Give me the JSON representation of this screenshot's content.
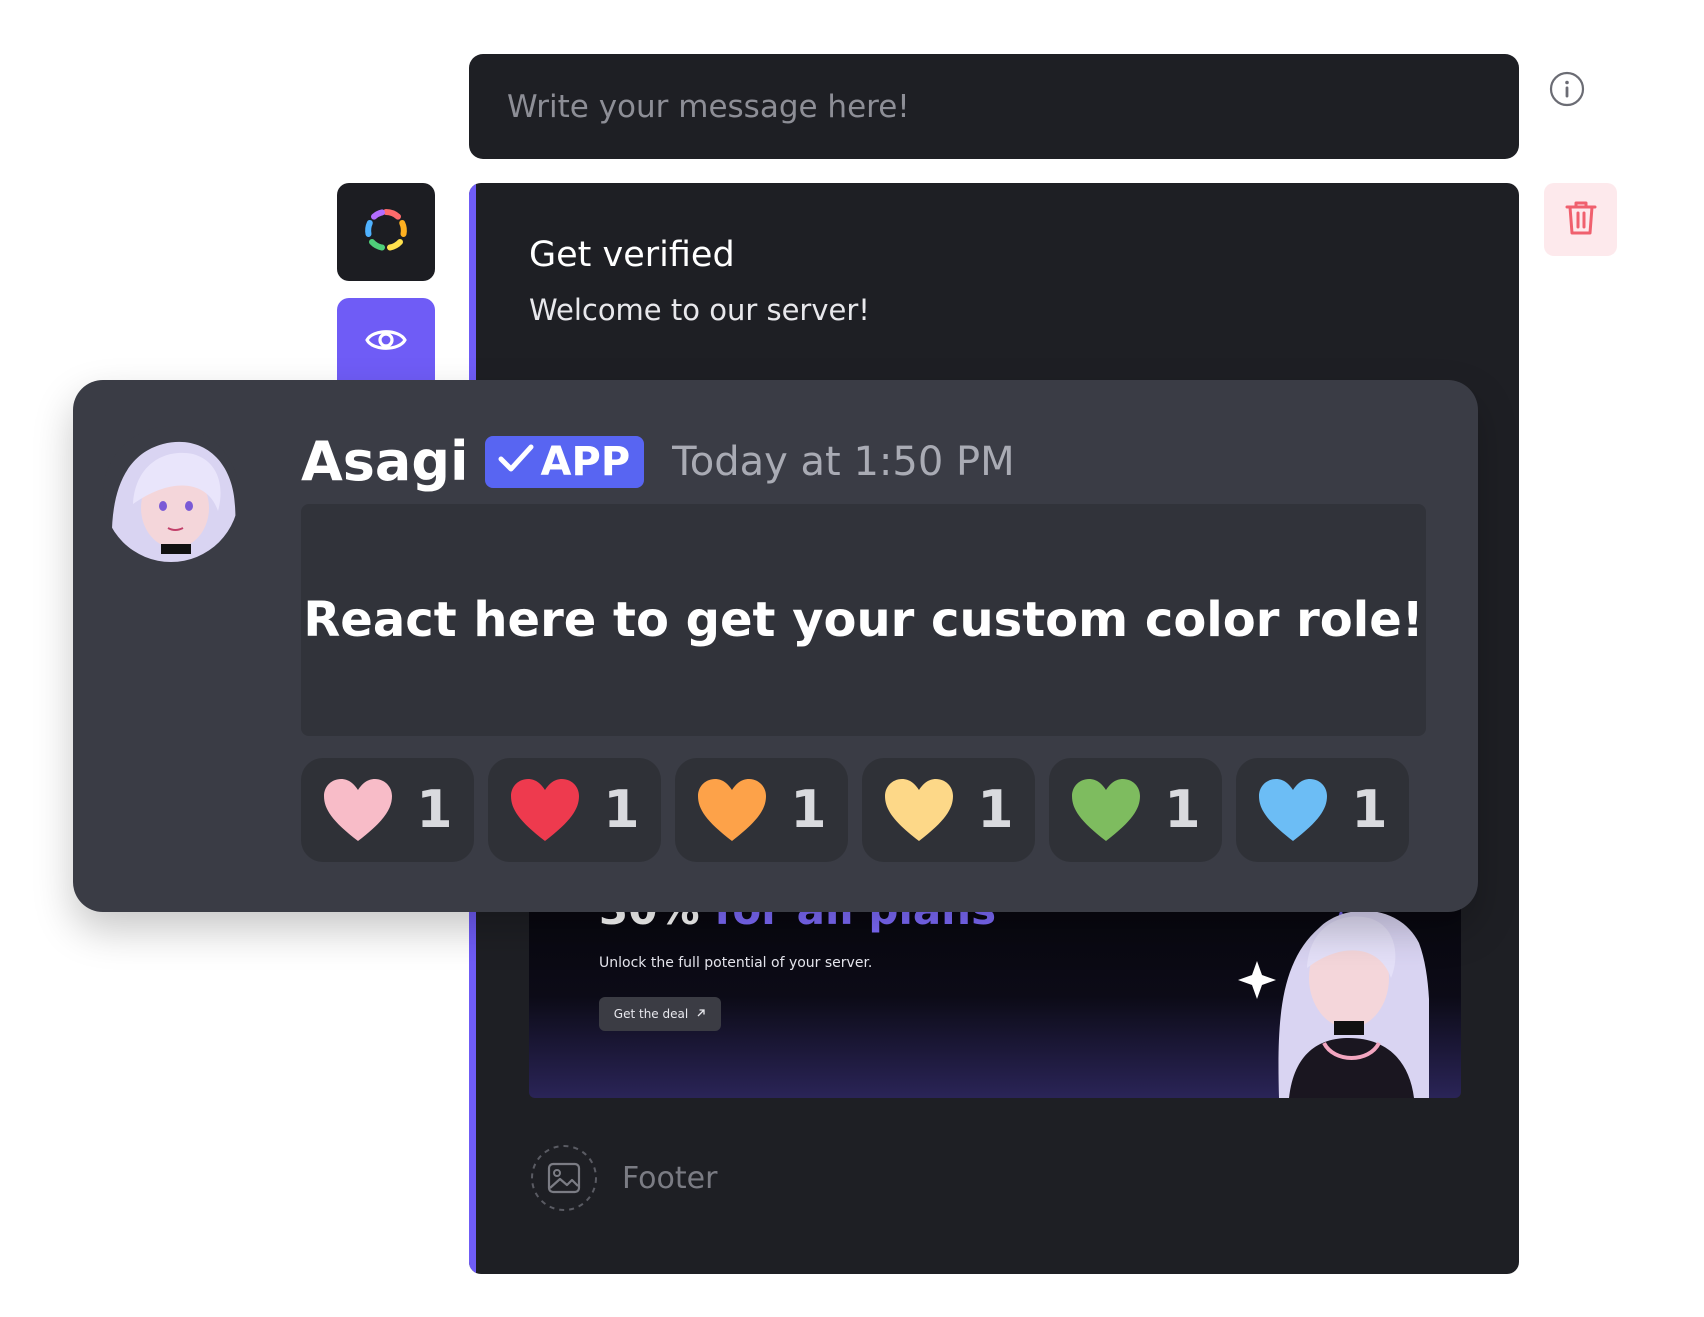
{
  "message_input": {
    "placeholder": "Write your message here!"
  },
  "icons": {
    "info": "info-icon",
    "color_picker": "color-wheel-icon",
    "preview": "eye-icon",
    "delete": "trash-icon",
    "footer_image": "image-placeholder-icon",
    "verified": "checkmark-icon"
  },
  "embed": {
    "title": "Get verified",
    "description": "Welcome to our server!",
    "accent_color": "#6f5cf6",
    "banner": {
      "headline_percent": "30%",
      "headline_text": "for all plans",
      "subtext": "Unlock the full potential of your server.",
      "button_label": "Get the deal"
    },
    "footer_label": "Footer"
  },
  "preview": {
    "author": "Asagi",
    "badge": "APP",
    "timestamp": "Today at 1:50 PM",
    "embed_text": "React here to get your custom color role!",
    "reactions": [
      {
        "emoji": "pink-heart",
        "color": "#f8bcc8",
        "count": "1"
      },
      {
        "emoji": "red-heart",
        "color": "#ee3a4e",
        "count": "1"
      },
      {
        "emoji": "orange-heart",
        "color": "#fda249",
        "count": "1"
      },
      {
        "emoji": "yellow-heart",
        "color": "#fdd888",
        "count": "1"
      },
      {
        "emoji": "green-heart",
        "color": "#7ebc5f",
        "count": "1"
      },
      {
        "emoji": "blue-heart",
        "color": "#6cbdf5",
        "count": "1"
      }
    ]
  },
  "colors": {
    "brand_purple": "#6f5cf6",
    "discord_blurple": "#5865f2",
    "dark_surface": "#1e1f24",
    "preview_surface": "#3a3c45"
  }
}
